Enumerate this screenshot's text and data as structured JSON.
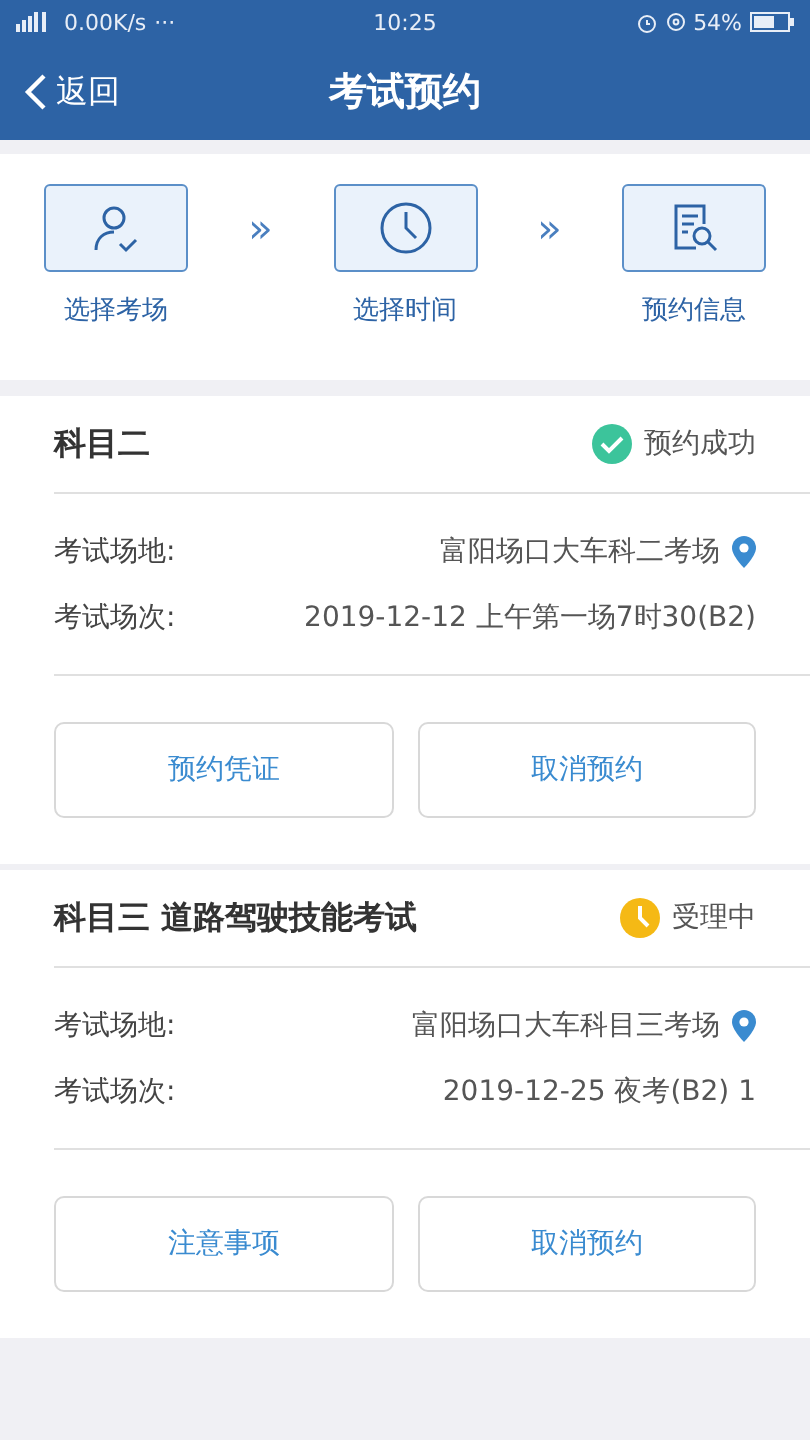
{
  "status_bar": {
    "speed": "0.00K/s",
    "more": "···",
    "time": "10:25",
    "battery": "54%"
  },
  "header": {
    "back": "返回",
    "title": "考试预约"
  },
  "steps": [
    {
      "label": "选择考场",
      "kind": "person"
    },
    {
      "label": "选择时间",
      "kind": "clock"
    },
    {
      "label": "预约信息",
      "kind": "document"
    }
  ],
  "step_separator": "»",
  "bookings": [
    {
      "subject": "科目二",
      "status": {
        "kind": "success",
        "text": "预约成功"
      },
      "fields": [
        {
          "label": "考试场地:",
          "value": "富阳场口大车科二考场",
          "pin": true
        },
        {
          "label": "考试场次:",
          "value": "2019-12-12 上午第一场7时30(B2)",
          "pin": false
        }
      ],
      "buttons": [
        "预约凭证",
        "取消预约"
      ]
    },
    {
      "subject": "科目三 道路驾驶技能考试",
      "status": {
        "kind": "pending",
        "text": "受理中"
      },
      "fields": [
        {
          "label": "考试场地:",
          "value": "富阳场口大车科目三考场",
          "pin": true
        },
        {
          "label": "考试场次:",
          "value": "2019-12-25 夜考(B2) 1",
          "pin": false
        }
      ],
      "buttons": [
        "注意事项",
        "取消预约"
      ]
    }
  ]
}
